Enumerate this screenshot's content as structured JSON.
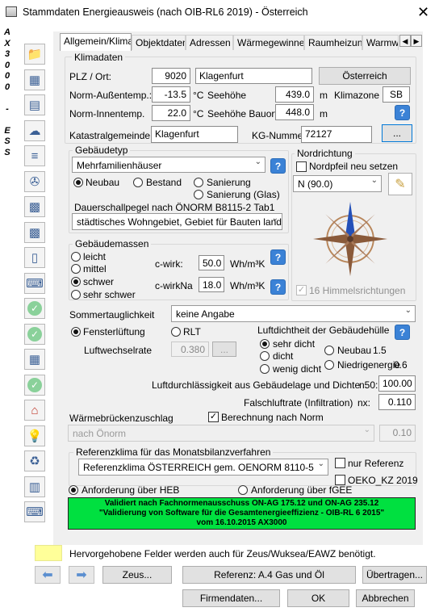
{
  "window": {
    "title": "Stammdaten Energieausweis (nach OIB-RL6 2019) - Österreich",
    "close_icon": "close-icon"
  },
  "left_strip": [
    "A",
    "X",
    "3",
    "0",
    "0",
    "0",
    "",
    "-",
    "",
    "E",
    "S",
    "S"
  ],
  "toolbar_icons": [
    "folder-icon",
    "calculator-icon",
    "contact-card-icon",
    "weather-icon",
    "radiator-icon",
    "pump-icon",
    "solar-panel-icon",
    "solar-panel-2-icon",
    "boiler-icon",
    "keyboard-icon",
    "check-icon",
    "check-icon",
    "document-add-icon",
    "check-icon",
    "house-icon",
    "lightbulb-icon",
    "recycle-icon",
    "building-icon",
    "keyboard-icon"
  ],
  "tabs": [
    "Allgemein/Klima",
    "Objektdaten",
    "Adressen",
    "Wärmegewinne",
    "Raumheizung",
    "Warmw"
  ],
  "klimadaten": {
    "legend": "Klimadaten",
    "plz_ort_label": "PLZ / Ort:",
    "plz": "9020",
    "ort": "Klagenfurt",
    "country_button": "Österreich",
    "aussentemp_label": "Norm-Außentemp.:",
    "aussentemp": "-13.5",
    "innentemp_label": "Norm-Innentemp.",
    "innentemp": "22.0",
    "unit_c": "°C",
    "seehoehe_label": "Seehöhe",
    "seehoehe": "439.0",
    "seehoehe_bauort_label": "Seehöhe Bauort",
    "seehoehe_bauort": "448.0",
    "unit_m": "m",
    "klimazone_label": "Klimazone",
    "klimazone": "SB",
    "katastral_label": "Katastralgemeinde",
    "katastral": "Klagenfurt",
    "kg_label": "KG-Nummer",
    "kg_nummer": "72127",
    "kg_button": "..."
  },
  "gebaeudetyp": {
    "legend": "Gebäudetyp",
    "selected": "Mehrfamilienhäuser",
    "neubau": "Neubau",
    "bestand": "Bestand",
    "sanierung": "Sanierung",
    "sanierung_glas": "Sanierung (Glas)",
    "dauerschall_label": "Dauerschallpegel nach ÖNORM B8115-2 Tab1",
    "dauerschall": "städtisches Wohngebiet, Gebiet für Bauten land"
  },
  "nordrichtung": {
    "legend": "Nordrichtung",
    "nordpfeil_label": "Nordpfeil neu setzen",
    "direction": "N  (90.0)",
    "himmel_label": "16  Himmelsrichtungen"
  },
  "gebaeudemassen": {
    "legend": "Gebäudemassen",
    "options": [
      "leicht",
      "mittel",
      "schwer",
      "sehr schwer"
    ],
    "cwirk_label": "c-wirk:",
    "cwirk": "50.0",
    "cwirkna_label": "c-wirkNa",
    "cwirkna": "18.0",
    "unit": "Wh/m³K"
  },
  "sommer": {
    "label": "Sommertauglichkeit",
    "value": "keine Angabe",
    "fenster": "Fensterlüftung",
    "rlt": "RLT",
    "luftwechsel_label": "Luftwechselrate",
    "luftwechsel": "0.380",
    "luftwechsel_btn": "..."
  },
  "luftdicht": {
    "label": "Luftdichtheit der Gebäudehülle",
    "sehr_dicht": "sehr dicht",
    "dicht": "dicht",
    "wenig_dicht": "wenig dicht",
    "neubau": "Neubau",
    "neubau_val": "1.5",
    "niedrig": "Niedrigenergie",
    "niedrig_val": "0.6",
    "durchl_label": "Luftdurchlässigkeit aus Gebäudelage und Dichte",
    "n50_label": "n50:",
    "n50": "100.00",
    "fall_label": "Falschluftrate (Infiltration)",
    "nx_label": "nx:",
    "nx": "0.110"
  },
  "waermebruecke": {
    "label": "Wärmebrückenzuschlag",
    "berechnung": "Berechnung nach Norm",
    "select": "nach Önorm",
    "value": "0.10"
  },
  "referenzklima": {
    "legend": "Referenzklima für das Monatsbilanzverfahren",
    "value": "Referenzklima ÖSTERREICH gem. OENORM 8110-5",
    "nur_referenz": "nur Referenz",
    "oeko": "OEKO_KZ 2019"
  },
  "anforderung": {
    "heb": "Anforderung über HEB",
    "fgee": "Anforderung über fGEE"
  },
  "validation": [
    "Validiert nach Fachnormenausschuss ON-AG 175.12 und ON-AG 235.12",
    "\"Validierung von Software für die Gesamtenergieeffizienz - OIB-RL 6 2015\"",
    "vom 16.10.2015 AX3000"
  ],
  "footer": {
    "hint": "Hervorgehobene Felder werden auch für Zeus/Wuksea/EAWZ benötigt.",
    "zeus": "Zeus...",
    "referenz": "Referenz: A.4 Gas und Öl",
    "uebertragen": "Übertragen...",
    "firmendaten": "Firmendaten...",
    "ok": "OK",
    "abbrechen": "Abbrechen"
  },
  "colors": {
    "validation_bg": "#00e040",
    "hint_yellow": "#ffff99",
    "help_blue": "#3b82d6"
  }
}
